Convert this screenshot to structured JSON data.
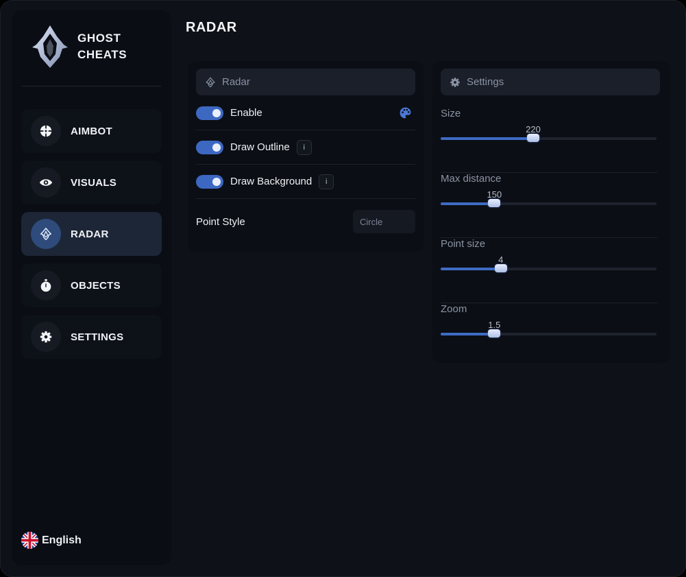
{
  "app": {
    "logo_line1": "GHOST",
    "logo_line2": "CHEATS",
    "accent_color": "#3d68c2"
  },
  "sidebar": {
    "items": [
      {
        "label": "AIMBOT",
        "icon": "crosshair-icon",
        "active": false
      },
      {
        "label": "VISUALS",
        "icon": "eye-icon",
        "active": false
      },
      {
        "label": "RADAR",
        "icon": "radar-icon",
        "active": true
      },
      {
        "label": "OBJECTS",
        "icon": "stopwatch-icon",
        "active": false
      },
      {
        "label": "SETTINGS",
        "icon": "gear-icon",
        "active": false
      }
    ],
    "language": {
      "label": "English",
      "icon": "uk-flag-icon"
    }
  },
  "page": {
    "title": "RADAR"
  },
  "radar_panel": {
    "header": "Radar",
    "toggles": [
      {
        "label": "Enable",
        "on": true
      },
      {
        "label": "Draw Outline",
        "on": true,
        "info": "i"
      },
      {
        "label": "Draw Background",
        "on": true,
        "info": "i"
      }
    ],
    "point_style": {
      "label": "Point Style",
      "value": "Circle"
    }
  },
  "settings_panel": {
    "header": "Settings",
    "sliders": [
      {
        "label": "Size",
        "value": "220",
        "fraction": 0.4
      },
      {
        "label": "Max distance",
        "value": "150",
        "fraction": 0.22
      },
      {
        "label": "Point size",
        "value": "4",
        "fraction": 0.25
      },
      {
        "label": "Zoom",
        "value": "1.5",
        "fraction": 0.22
      }
    ]
  }
}
